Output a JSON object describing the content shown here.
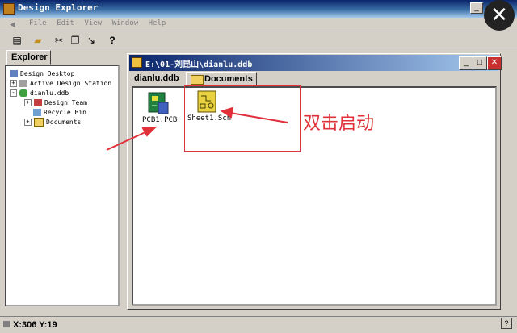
{
  "window": {
    "title": "Design Explorer"
  },
  "menu": {
    "items": [
      "File",
      "Edit",
      "View",
      "Window",
      "Help"
    ]
  },
  "explorer": {
    "tab_label": "Explorer",
    "tree": [
      {
        "label": "Design Desktop",
        "indent": 0,
        "expander": "",
        "icon": "desktop-icon"
      },
      {
        "label": "Active Design Station",
        "indent": 1,
        "expander": "+",
        "icon": "station-icon"
      },
      {
        "label": "dianlu.ddb",
        "indent": 1,
        "expander": "-",
        "icon": "database-icon"
      },
      {
        "label": "Design Team",
        "indent": 2,
        "expander": "+",
        "icon": "team-icon"
      },
      {
        "label": "Recycle Bin",
        "indent": 2,
        "expander": "",
        "icon": "recycle-bin-icon"
      },
      {
        "label": "Documents",
        "indent": 2,
        "expander": "+",
        "icon": "folder-icon"
      }
    ]
  },
  "child_window": {
    "title": "E:\\01-刘昆山\\dianlu.ddb",
    "tabs": {
      "dianlu": "dianlu.ddb",
      "documents": "Documents"
    },
    "files": [
      {
        "label": "PCB1.PCB",
        "icon": "pcb-file-icon"
      },
      {
        "label": "Sheet1.Sch",
        "icon": "schematic-file-icon"
      }
    ]
  },
  "annotation": {
    "text": "双击启动",
    "color": "#e0303a"
  },
  "status": {
    "coords": "X:306 Y:19",
    "help": "?"
  },
  "colors": {
    "title_start": "#0a246a",
    "title_end": "#a6caf0",
    "face": "#d4d0c8"
  }
}
